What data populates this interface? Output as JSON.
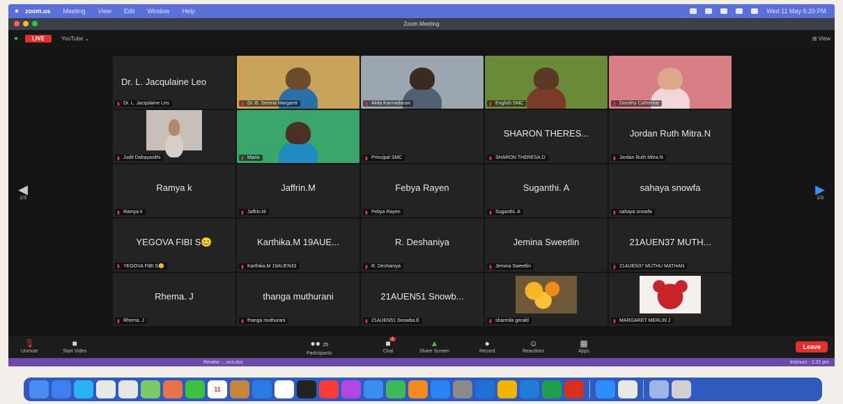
{
  "menubar": {
    "app": "zoom.us",
    "items": [
      "Meeting",
      "View",
      "Edit",
      "Window",
      "Help"
    ],
    "clock": "Wed 11 May 6:20 PM"
  },
  "window": {
    "title": "Zoom Meeting"
  },
  "topbar": {
    "live_label": "LIVE",
    "stream_label": "YouTube ⌄",
    "view_label": "⊞ View"
  },
  "participants": [
    {
      "big": "Dr. L. Jacqulaine Leo",
      "label": "Dr. L. Jacqulaine Leo",
      "video": false
    },
    {
      "big": "",
      "label": "Dr. B. Serena Margaret",
      "video": true,
      "bg": "#c9a25a",
      "skin": "#6b4a2e",
      "shirt": "#2a6fa8",
      "active": true
    },
    {
      "big": "",
      "label": "Akila Kannadasan",
      "video": true,
      "bg": "#9aa6b0",
      "skin": "#3a2a20",
      "shirt": "#506070"
    },
    {
      "big": "",
      "label": "English SMC",
      "video": true,
      "bg": "#6a8a3a",
      "skin": "#5a3a24",
      "shirt": "#7a3b28"
    },
    {
      "big": "",
      "label": "Dorothy Catherine",
      "video": true,
      "bg": "#d87f85",
      "skin": "#d9a98a",
      "shirt": "#f1d6d8"
    },
    {
      "big": "",
      "label": "Judit Dahayasithi",
      "video": true,
      "bg": "#c8c0b8",
      "skin": "#b08a6a",
      "shirt": "#d8d0c8",
      "small": true
    },
    {
      "big": "",
      "label": "Mario",
      "video": true,
      "bg": "#3aa46a",
      "skin": "#4a3020",
      "shirt": "#1e8cc0"
    },
    {
      "big": "",
      "label": "Principal SMC",
      "video": false
    },
    {
      "big": "SHARON THERES...",
      "label": "SHARON THERESA.D",
      "video": false
    },
    {
      "big": "Jordan Ruth Mitra.N",
      "label": "Jordan Ruth Mitra.N",
      "video": false
    },
    {
      "big": "Ramya k",
      "label": "Ramya k",
      "video": false
    },
    {
      "big": "Jaffrin.M",
      "label": "Jaffrin.M",
      "video": false
    },
    {
      "big": "Febya Rayen",
      "label": "Febya Rayen",
      "video": false
    },
    {
      "big": "Suganthi. A",
      "label": "Suganthi. A",
      "video": false
    },
    {
      "big": "sahaya snowfa",
      "label": "sahaya snowfa",
      "video": false
    },
    {
      "big": "YEGOVA FIBI S😊",
      "label": "YEGOVA FIBI S😊",
      "video": false
    },
    {
      "big": "Karthika.M 19AUE...",
      "label": "Karthika.M 19AUEN33",
      "video": false
    },
    {
      "big": "R. Deshaniya",
      "label": "R. Deshaniya",
      "video": false
    },
    {
      "big": "Jemina Sweetlin",
      "label": "Jemina Sweetlin",
      "video": false
    },
    {
      "big": "21AUEN37 MUTH...",
      "label": "21AUEN37 MUTHU MATHAN",
      "video": false
    },
    {
      "big": "Rhema. J",
      "label": "Rhema. J",
      "video": false
    },
    {
      "big": "thanga muthurani",
      "label": "thanga muthurani",
      "video": false
    },
    {
      "big": "21AUEN51 Snowb...",
      "label": "21AUEN51 Snowba.E",
      "video": false
    },
    {
      "big": "",
      "label": "sharmila gerald",
      "video": "flowers"
    },
    {
      "big": "",
      "label": "MARGARET MERLIN J",
      "video": "teddy"
    }
  ],
  "paging": {
    "left": "1/3",
    "right": "1/3"
  },
  "toolbar": {
    "unmute": "Unmute",
    "start_video": "Start Video",
    "participants": "Participants",
    "participants_count": "25",
    "chat": "Chat",
    "chat_badge": "1",
    "share": "Share Screen",
    "record": "Record",
    "reactions": "Reactions",
    "apps": "Apps",
    "leave": "Leave"
  },
  "status": {
    "doc": "Review -...ocs.doc",
    "time": "Instnuct · 1:22 pm"
  },
  "dock": {
    "colors": [
      "#4a8cf0",
      "#3f7df0",
      "#2ab0f5",
      "#e9e9e9",
      "#e6e6e6",
      "#7ac96a",
      "#e9714b",
      "#3ec13e",
      "#ffffff",
      "#c7843b",
      "#2c7be5",
      "#ffffff",
      "#222222",
      "#fa3b3b",
      "#b346e0",
      "#3a8ef0",
      "#3fb85a",
      "#f58a1f",
      "#2a84f5",
      "#8a8a8a",
      "#1f6fd6",
      "#f0b400",
      "#1c7cd6",
      "#1e9e4a",
      "#d83020",
      "#2d8cff",
      "#e9e9e9",
      "#9fb4ea",
      "#d0d0d0"
    ],
    "calendar_day": "11"
  }
}
